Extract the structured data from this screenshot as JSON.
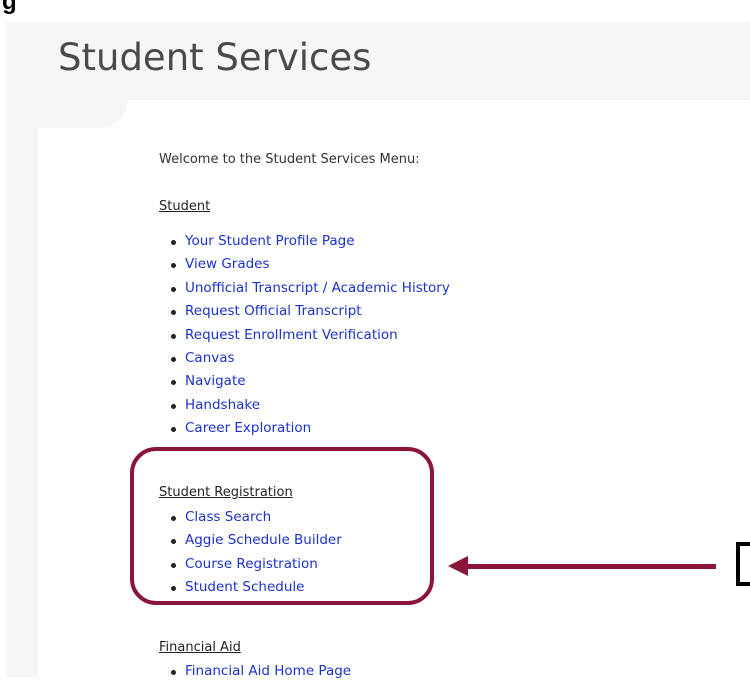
{
  "page_title": "Student Services",
  "welcome_text": "Welcome to the Student Services Menu:",
  "sections": {
    "student": {
      "heading": "Student",
      "links": [
        "Your Student Profile Page",
        "View Grades",
        "Unofficial Transcript / Academic History",
        "Request Official Transcript",
        "Request Enrollment Verification",
        "Canvas",
        "Navigate",
        "Handshake",
        "Career Exploration"
      ]
    },
    "registration": {
      "heading": "Student Registration",
      "links": [
        "Class Search",
        "Aggie Schedule Builder",
        "Course Registration",
        "Student Schedule"
      ]
    },
    "financial_aid": {
      "heading": "Financial Aid",
      "links": [
        "Financial Aid Home Page"
      ]
    }
  },
  "colors": {
    "link": "#1a32c8",
    "annotation": "#8b1538",
    "header_bg": "#f5f6f6"
  }
}
